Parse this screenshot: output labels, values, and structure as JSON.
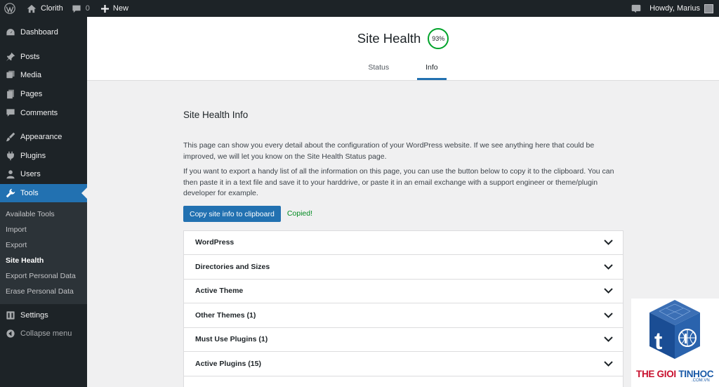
{
  "adminbar": {
    "site_name": "Clorith",
    "comments_count": "0",
    "new_label": "New",
    "howdy": "Howdy, Marius"
  },
  "sidebar": {
    "items": [
      {
        "label": "Dashboard",
        "icon": "dashboard-icon"
      },
      {
        "label": "Posts",
        "icon": "pin-icon"
      },
      {
        "label": "Media",
        "icon": "media-icon"
      },
      {
        "label": "Pages",
        "icon": "pages-icon"
      },
      {
        "label": "Comments",
        "icon": "comment-icon"
      },
      {
        "label": "Appearance",
        "icon": "brush-icon"
      },
      {
        "label": "Plugins",
        "icon": "plugin-icon"
      },
      {
        "label": "Users",
        "icon": "user-icon"
      },
      {
        "label": "Tools",
        "icon": "wrench-icon"
      },
      {
        "label": "Settings",
        "icon": "settings-icon"
      },
      {
        "label": "Collapse menu",
        "icon": "collapse-icon"
      }
    ],
    "tools_submenu": [
      "Available Tools",
      "Import",
      "Export",
      "Site Health",
      "Export Personal Data",
      "Erase Personal Data"
    ]
  },
  "header": {
    "title": "Site Health",
    "score": "93%",
    "tabs": [
      "Status",
      "Info"
    ]
  },
  "content": {
    "heading": "Site Health Info",
    "para1": "This page can show you every detail about the configuration of your WordPress website. If we see anything here that could be improved, we will let you know on the Site Health Status page.",
    "para2": "If you want to export a handy list of all the information on this page, you can use the button below to copy it to the clipboard. You can then paste it in a text file and save it to your harddrive, or paste it in an email exchange with a support engineer or theme/plugin developer for example.",
    "copy_button": "Copy site info to clipboard",
    "copied": "Copied!",
    "sections": [
      "WordPress",
      "Directories and Sizes",
      "Active Theme",
      "Other Themes (1)",
      "Must Use Plugins (1)",
      "Active Plugins (15)"
    ]
  },
  "watermark": {
    "text_red": "THE GIOI",
    "text_blue": "TINHOC",
    "sub": ".COM.VN"
  },
  "colors": {
    "admin_dark": "#1d2327",
    "accent": "#2271b1",
    "good": "#00a32a"
  }
}
